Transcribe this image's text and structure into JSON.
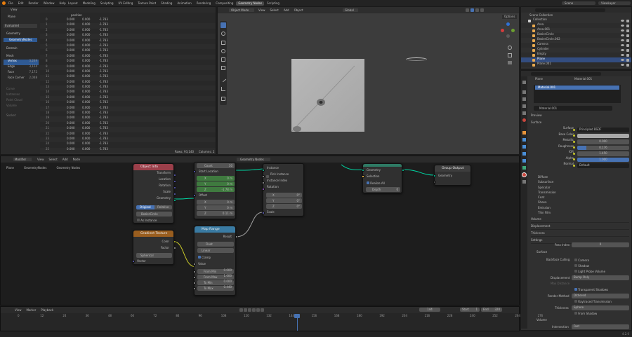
{
  "app": {
    "menu": [
      "File",
      "Edit",
      "Render",
      "Window",
      "Help"
    ],
    "workspaces": [
      "Layout",
      "Modeling",
      "Sculpting",
      "UV Editing",
      "Texture Paint",
      "Shading",
      "Animation",
      "Rendering",
      "Compositing",
      "Geometry Nodes",
      "Scripting"
    ],
    "active_workspace": "Geometry Nodes",
    "scene": "Scene",
    "view_layer": "ViewLayer"
  },
  "spreadsheet": {
    "header_menu": "View",
    "object": "Plane",
    "evaluated": "Evaluated",
    "geometry_label": "Geometry",
    "geometry_item": "GeometryNodes",
    "domain_label": "Domain",
    "mesh_label": "Mesh",
    "domains": [
      {
        "name": "Vertex",
        "count": "3,249"
      },
      {
        "name": "Edge",
        "count": "3,124"
      },
      {
        "name": "Face",
        "count": "7,172"
      },
      {
        "name": "Face Corner",
        "count": "2,048"
      }
    ],
    "disabled_items": [
      "Curve",
      "Instances",
      "Point Cloud",
      "Volume"
    ],
    "extra": "Socket",
    "column": "position",
    "rows": [
      [
        "0",
        "0.000",
        "0.000",
        "-1.783"
      ],
      [
        "1",
        "0.000",
        "0.000",
        "-1.783"
      ],
      [
        "2",
        "0.000",
        "0.000",
        "-1.783"
      ],
      [
        "3",
        "0.000",
        "0.000",
        "-1.783"
      ],
      [
        "4",
        "0.000",
        "0.000",
        "-1.783"
      ],
      [
        "5",
        "0.000",
        "0.000",
        "-1.783"
      ],
      [
        "6",
        "0.000",
        "0.000",
        "-1.783"
      ],
      [
        "7",
        "0.000",
        "0.000",
        "-1.783"
      ],
      [
        "8",
        "0.000",
        "0.000",
        "-1.783"
      ],
      [
        "9",
        "0.000",
        "0.000",
        "-1.783"
      ],
      [
        "10",
        "0.000",
        "0.000",
        "-1.783"
      ],
      [
        "11",
        "0.000",
        "0.000",
        "-1.783"
      ],
      [
        "12",
        "0.000",
        "0.000",
        "-1.783"
      ],
      [
        "13",
        "0.000",
        "0.000",
        "-1.783"
      ],
      [
        "14",
        "0.000",
        "0.000",
        "-1.783"
      ],
      [
        "15",
        "0.000",
        "0.000",
        "-1.783"
      ],
      [
        "16",
        "0.000",
        "0.000",
        "-1.783"
      ],
      [
        "17",
        "0.000",
        "0.000",
        "-1.783"
      ],
      [
        "18",
        "0.000",
        "0.000",
        "-1.783"
      ],
      [
        "19",
        "0.000",
        "0.000",
        "-1.783"
      ],
      [
        "20",
        "0.000",
        "0.000",
        "-1.783"
      ],
      [
        "21",
        "0.000",
        "0.000",
        "-1.783"
      ],
      [
        "22",
        "0.000",
        "0.000",
        "-1.783"
      ],
      [
        "23",
        "0.000",
        "0.000",
        "-1.783"
      ],
      [
        "24",
        "0.000",
        "0.000",
        "-1.783"
      ],
      [
        "25",
        "0.000",
        "0.000",
        "-1.783"
      ]
    ],
    "footer_rows": "Rows: 93,140",
    "footer_cols": "Columns: 2"
  },
  "viewport": {
    "mode": "Object Mode",
    "menu": [
      "View",
      "Select",
      "Add",
      "Object"
    ],
    "transform": "Global",
    "options": "Options"
  },
  "node_editor": {
    "editor_menu": "Modifier",
    "menu": [
      "View",
      "Select",
      "Add",
      "Node"
    ],
    "tree": "Geometry Nodes",
    "crumbs": [
      "Plane",
      "GeometryNodes",
      "Geometry Nodes"
    ],
    "object_info": {
      "title": "Object Info",
      "outs": [
        "Transform",
        "Location",
        "Rotation",
        "Scale",
        "Geometry"
      ],
      "modes": [
        "Original",
        "Relative"
      ],
      "object": "BezierCircle",
      "as_instance": "As Instance"
    },
    "instance": {
      "count": "Count",
      "count_v": "30",
      "start": "Start Location",
      "x": "X",
      "y": "Y",
      "z": "Z",
      "sx": "0 m",
      "sy": "0 m",
      "sz": "-1.78 m",
      "offset": "Offset",
      "ox": "0 m",
      "oy": "0 m",
      "oz": "0.11 m"
    },
    "iop": {
      "title": "",
      "ins": [
        "Instance",
        "Pick Instance",
        "Instance Index",
        "Rotation"
      ],
      "rx": "0°",
      "ry": "0°",
      "rz": "0°",
      "x": "X",
      "y": "Y",
      "z": "Z",
      "scale": "Scale"
    },
    "realize": {
      "title": "",
      "geometry": "Geometry",
      "selection": "Selection",
      "realize_all": "Realize All",
      "depth": "Depth",
      "depth_v": "0"
    },
    "group_output": {
      "title": "Group Output",
      "geometry": "Geometry"
    },
    "gradient": {
      "title": "Gradient Texture",
      "outs": [
        "Color",
        "Factor"
      ],
      "type": "Spherical",
      "vector": "Vector"
    },
    "map_range": {
      "title": "Map Range",
      "result": "Result",
      "float": "Float",
      "linear": "Linear",
      "clamp": "Clamp",
      "value": "Value",
      "fields": [
        {
          "l": "From Min",
          "v": "0.000"
        },
        {
          "l": "From Max",
          "v": "1.000"
        },
        {
          "l": "To Min",
          "v": "0.000"
        },
        {
          "l": "To Max",
          "v": "0.440"
        }
      ]
    }
  },
  "outliner": {
    "title": "Scene Collection",
    "items": [
      {
        "n": "Collection",
        "c": "#d0d0d0"
      },
      {
        "n": "Area",
        "c": "#e8a94f"
      },
      {
        "n": "Area.001",
        "c": "#e8a94f"
      },
      {
        "n": "BezierCircle",
        "c": "#e8a94f"
      },
      {
        "n": "BezierCircle.002",
        "c": "#e8a94f"
      },
      {
        "n": "Camera",
        "c": "#e8a94f"
      },
      {
        "n": "Cylinder",
        "c": "#e8a94f"
      },
      {
        "n": "Empty",
        "c": "#e8a94f"
      },
      {
        "n": "Plane",
        "c": "#e8a94f"
      },
      {
        "n": "Plane.001",
        "c": "#e8a94f"
      }
    ]
  },
  "properties": {
    "object": "Plane",
    "material": "Material.001",
    "slot": "Material.001",
    "mat_field": "Material.001",
    "preview": "Preview",
    "surface": "Surface",
    "surface_label": "Surface",
    "surface_v": "Principled BSDF",
    "base_color": "Base Color",
    "metallic": "Metallic",
    "metallic_v": "0.000",
    "roughness": "Roughness",
    "roughness_v": "0.176",
    "ior": "IOR",
    "ior_v": "1.450",
    "alpha": "Alpha",
    "alpha_v": "1.000",
    "normal": "Normal",
    "normal_v": "Default",
    "sub": [
      "Diffuse",
      "Subsurface",
      "Specular",
      "Transmission",
      "Coat",
      "Sheen",
      "Emission",
      "Thin Film"
    ],
    "sections": [
      "Volume",
      "Displacement",
      "Thickness",
      "Settings"
    ],
    "pass_index": "Pass Index",
    "pass_v": "0",
    "surface_sub": "Surface",
    "backface": "Backface Culling",
    "camera": "Camera",
    "shadow": "Shadow",
    "light_probe": "Light Probe Volume",
    "displacement": "Displacement",
    "displacement_v": "Bump Only",
    "max_dist": "Max Distance",
    "transparent_shadows": "Transparent Shadows",
    "render_method": "Render Method",
    "render_v": "Dithered",
    "raytraced": "Raytraced Transmission",
    "thickness": "Thickness",
    "thickness_v": "Sphere",
    "from_shadow": "From Shadow",
    "volume": "Volume",
    "intersection": "Intersection",
    "intersection_v": "Fast"
  },
  "timeline": {
    "menu": [
      "View",
      "Marker",
      "Playback"
    ],
    "frame": "144",
    "start": "Start",
    "start_v": "1",
    "end": "End",
    "end_v": "320",
    "ticks": [
      "0",
      "12",
      "24",
      "36",
      "48",
      "60",
      "72",
      "84",
      "96",
      "108",
      "120",
      "132",
      "144",
      "156",
      "168",
      "180",
      "192",
      "204",
      "216",
      "228",
      "240",
      "252",
      "264",
      "276"
    ]
  },
  "statusbar": {
    "version": "4.2.0"
  }
}
